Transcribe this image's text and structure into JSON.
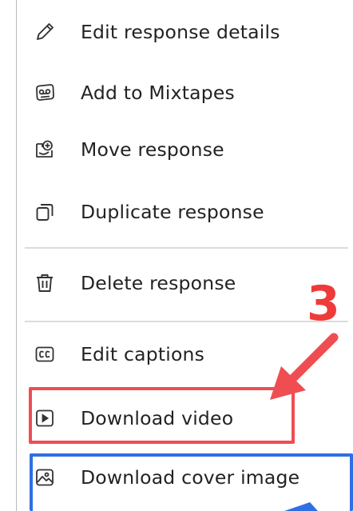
{
  "menu": {
    "items": [
      {
        "label": "Edit response details",
        "icon": "pencil-icon"
      },
      {
        "label": "Add to Mixtapes",
        "icon": "mixtape-icon"
      },
      {
        "label": "Move response",
        "icon": "move-icon"
      },
      {
        "label": "Duplicate response",
        "icon": "duplicate-icon"
      },
      {
        "label": "Delete response",
        "icon": "trash-icon"
      },
      {
        "label": "Edit captions",
        "icon": "captions-icon"
      },
      {
        "label": "Download video",
        "icon": "play-box-icon"
      },
      {
        "label": "Download cover image",
        "icon": "image-icon"
      }
    ]
  },
  "annotation": {
    "step_number": "3",
    "highlight_color_primary": "#ef4d52",
    "highlight_color_secondary": "#2f6fe4"
  }
}
